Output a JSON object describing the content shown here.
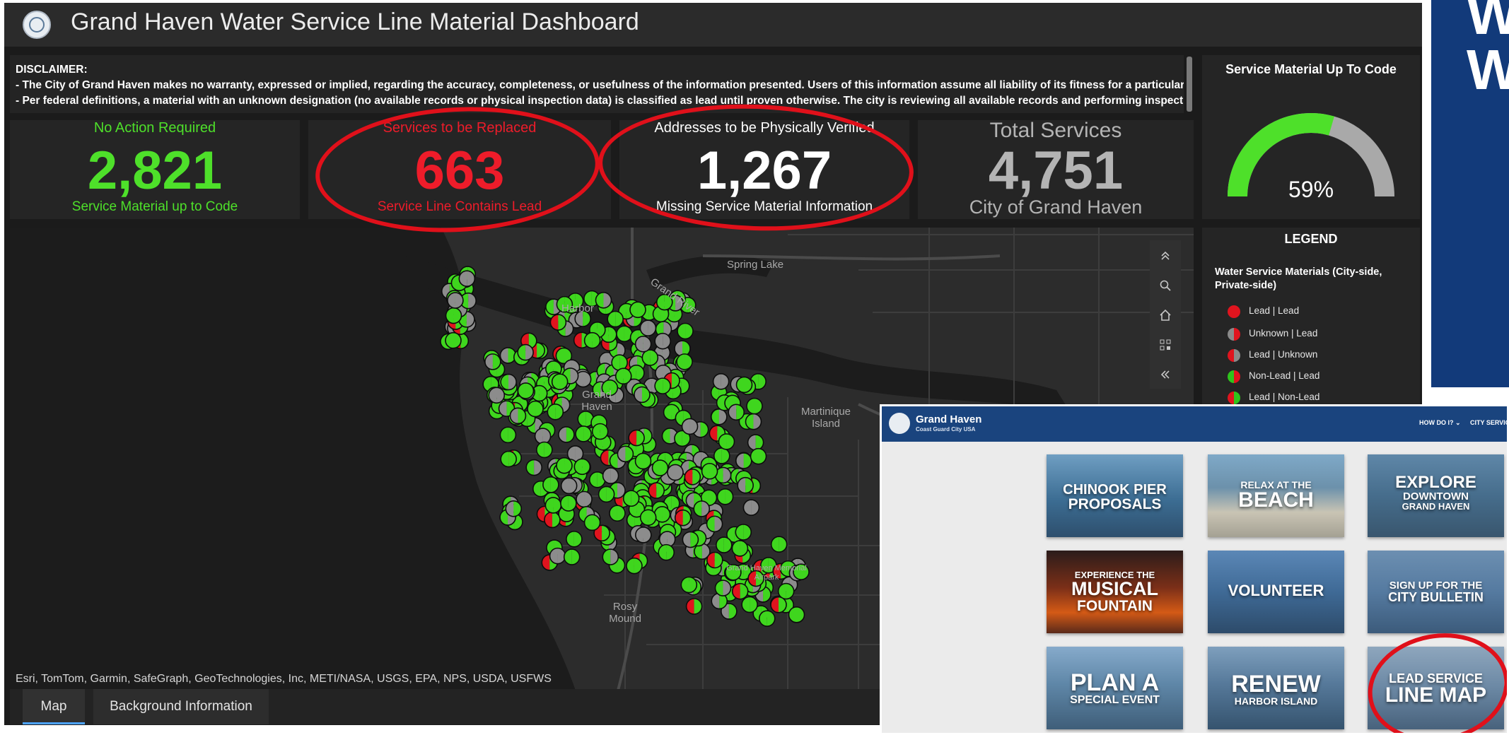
{
  "dashboard": {
    "title": "Grand Haven Water Service Line Material Dashboard",
    "disclaimer": {
      "heading": "DISCLAIMER:",
      "line1": "- The City of Grand Haven makes no warranty, expressed or implied, regarding the accuracy, completeness, or usefulness of the information presented. Users of this information assume all liability of its fitness for a particular use.",
      "line2": "- Per federal definitions, a material with an unknown designation (no available records or physical inspection data) is classified as lead until proven otherwise. The city is reviewing all available records and performing inspections"
    },
    "stats": [
      {
        "title": "No Action Required",
        "value": "2,821",
        "subtitle": "Service Material up to Code",
        "color": "#4ee02a"
      },
      {
        "title": "Services to be Replaced",
        "value": "663",
        "subtitle": "Service Line Contains Lead",
        "color": "#ee1c2a"
      },
      {
        "title": "Addresses to be Physically Verified",
        "value": "1,267",
        "subtitle": "Missing Service Material Information",
        "color": "#ffffff"
      },
      {
        "title": "Total Services",
        "value": "4,751",
        "subtitle": "City of Grand Haven",
        "color": "#b4b4b4"
      }
    ],
    "gauge": {
      "title": "Service Material Up To Code",
      "percent_label": "59%",
      "fraction": 0.59,
      "fill_color": "#4ee02a",
      "track_color": "#a9a9a9"
    },
    "legend": {
      "title": "LEGEND",
      "subtitle": "Water Service Materials (City-side, Private-side)",
      "items": [
        {
          "label": "Lead | Lead",
          "left": "#e0141e",
          "right": "#e0141e"
        },
        {
          "label": "Unknown | Lead",
          "left": "#8a8a8a",
          "right": "#e0141e"
        },
        {
          "label": "Lead | Unknown",
          "left": "#e0141e",
          "right": "#8a8a8a"
        },
        {
          "label": "Non-Lead | Lead",
          "left": "#2fc41c",
          "right": "#e0141e"
        },
        {
          "label": "Lead | Non-Lead",
          "left": "#e0141e",
          "right": "#2fc41c"
        }
      ]
    },
    "map": {
      "labels": {
        "spring_lake": "Spring Lake",
        "grand_river": "Grand River",
        "harbor": "Harbor",
        "grand_haven": "Grand Haven",
        "martinique": "Martinique Island",
        "rosy_mound": "Rosy Mound",
        "airport": "Grand Haven Memorial Airpark"
      },
      "attribution": "Esri, TomTom, Garmin, SafeGraph, GeoTechnologies, Inc, METI/NASA, USGS, EPA, NPS, USDA, USFWS",
      "tools": [
        "expand-icon",
        "search-icon",
        "home-icon",
        "qr-icon",
        "collapse-icon"
      ]
    },
    "tabs": [
      "Map",
      "Background Information"
    ]
  },
  "blue_panel": {
    "text": "W W"
  },
  "website": {
    "name": "Grand Haven",
    "tagline": "Coast Guard City USA",
    "nav": [
      "HOW DO I? ⌄",
      "CITY SERVICES"
    ],
    "tiles": [
      {
        "line1": "CHINOOK PIER",
        "line2": "PROPOSALS"
      },
      {
        "line1": "RELAX AT THE",
        "line2": "BEACH"
      },
      {
        "line1": "EXPLORE",
        "line2": "DOWNTOWN",
        "line3": "GRAND HAVEN"
      },
      {
        "line1": "EXPERIENCE THE",
        "line2": "MUSICAL",
        "line3": "FOUNTAIN"
      },
      {
        "line1": "VOLUNTEER"
      },
      {
        "line1": "SIGN UP FOR THE",
        "line2": "CITY BULLETIN"
      },
      {
        "line1": "PLAN A",
        "line2": "SPECIAL EVENT"
      },
      {
        "line1": "RENEW",
        "line2": "HARBOR ISLAND"
      },
      {
        "line1": "LEAD SERVICE",
        "line2": "LINE MAP"
      }
    ]
  }
}
